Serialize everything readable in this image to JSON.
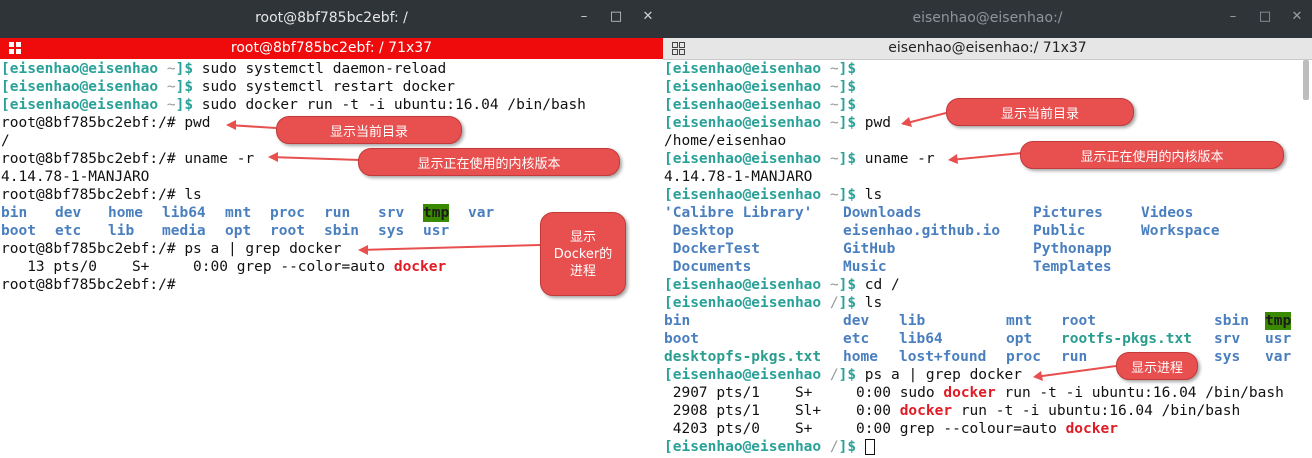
{
  "left": {
    "window_title": "root@8bf785bc2ebf: /",
    "tab_title": "root@8bf785bc2ebf: / 71x37",
    "lines": [
      {
        "user": "[eisenhao@eisenhao",
        "path": " ~",
        "close": "]$",
        "cmd": " sudo systemctl daemon-reload"
      },
      {
        "user": "[eisenhao@eisenhao",
        "path": " ~",
        "close": "]$",
        "cmd": " sudo systemctl restart docker"
      },
      {
        "user": "[eisenhao@eisenhao",
        "path": " ~",
        "close": "]$",
        "cmd": " sudo docker run -t -i ubuntu:16.04 /bin/bash"
      },
      {
        "text": "root@8bf785bc2ebf:/# pwd"
      },
      {
        "text": "/"
      },
      {
        "text": "root@8bf785bc2ebf:/# uname -r"
      },
      {
        "text": "4.14.78-1-MANJARO"
      },
      {
        "text": "root@8bf785bc2ebf:/# ls"
      },
      {
        "ls": [
          "bin",
          "dev",
          "home",
          "lib64",
          "mnt",
          "proc",
          "run",
          "srv",
          "tmp",
          "var"
        ]
      },
      {
        "ls": [
          "boot",
          "etc",
          "lib",
          "media",
          "opt",
          "root",
          "sbin",
          "sys",
          "usr"
        ]
      },
      {
        "text": "root@8bf785bc2ebf:/# ps a | grep docker"
      },
      {
        "pre": "   13 pts/0    S+     0:00 grep --color=auto ",
        "hl": "docker"
      },
      {
        "text": "root@8bf785bc2ebf:/#"
      }
    ],
    "callouts": [
      "显示当前目录",
      "显示正在使用的内核版本",
      "显示\nDocker的\n进程"
    ]
  },
  "right": {
    "window_title": "eisenhao@eisenhao:/",
    "tab_title": "eisenhao@eisenhao:/ 71x37",
    "prompt_user": "[eisenhao@eisenhao",
    "lines": [
      {
        "path": " ~",
        "cmd": ""
      },
      {
        "path": " ~",
        "cmd": ""
      },
      {
        "path": " ~",
        "cmd": ""
      },
      {
        "path": " ~",
        "cmd": " pwd"
      },
      {
        "text": "/home/eisenhao"
      },
      {
        "path": " ~",
        "cmd": " uname -r"
      },
      {
        "text": "4.14.78-1-MANJARO"
      },
      {
        "path": " ~",
        "cmd": " ls"
      },
      {
        "cols": [
          "'Calibre Library'",
          "Downloads",
          "Pictures",
          "Videos"
        ]
      },
      {
        "cols": [
          " Desktop",
          "eisenhao.github.io",
          "Public",
          "Workspace"
        ]
      },
      {
        "cols": [
          " DockerTest",
          "GitHub",
          "Pythonapp",
          ""
        ]
      },
      {
        "cols": [
          " Documents",
          "Music",
          "Templates",
          ""
        ]
      },
      {
        "path": " ~",
        "cmd": " cd /"
      },
      {
        "path": " /",
        "cmd": " ls"
      },
      {
        "ls": [
          "bin",
          "dev",
          "lib",
          "mnt",
          "root",
          "sbin",
          "tmp"
        ]
      },
      {
        "ls": [
          "boot",
          "etc",
          "lib64",
          "opt",
          "rootfs-pkgs.txt",
          "srv",
          "usr"
        ]
      },
      {
        "ls": [
          "desktopfs-pkgs.txt",
          "home",
          "lost+found",
          "proc",
          "run",
          "sys",
          "var"
        ]
      },
      {
        "path": " /",
        "cmd": " ps a | grep docker"
      },
      {
        "p1": " 2907 pts/1    S+     0:00 sudo ",
        "h1": "docker",
        "p2": " run -t -i ubuntu:16.04 /bin/bash"
      },
      {
        "p1": " 2908 pts/1    Sl+    0:00 ",
        "h1": "docker",
        "p2": " run -t -i ubuntu:16.04 /bin/bash"
      },
      {
        "p1": " 4203 pts/0    S+     0:00 grep --colour=auto ",
        "h1": "docker",
        "p2": ""
      },
      {
        "path": " /",
        "cmd": " ",
        "cursor": true
      }
    ],
    "callouts": [
      "显示当前目录",
      "显示正在使用的内核版本",
      "显示进程"
    ]
  },
  "icons": [
    "minimize-icon",
    "maximize-icon",
    "close-icon",
    "terminal-tab-icon"
  ],
  "colors": {
    "tab_active": "#ef0b0b",
    "callout": "#e84f4f",
    "prompt": "#2aa198",
    "dir": "#4a7fbf",
    "highlight": "#e01b24",
    "tmp_bg": "#3a8a00"
  }
}
